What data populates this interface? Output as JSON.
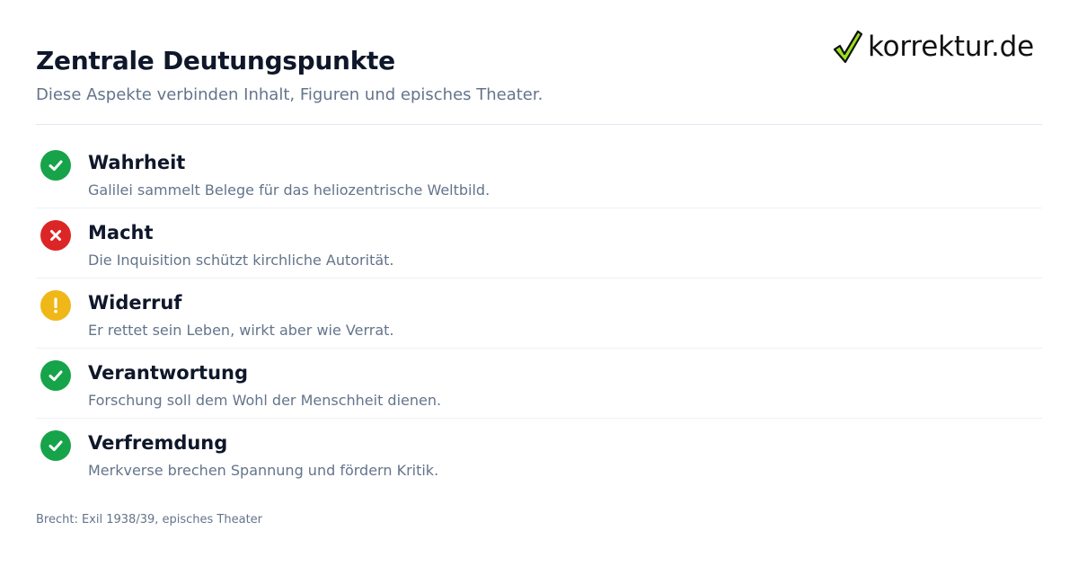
{
  "header": {
    "title": "Zentrale Deutungspunkte",
    "subtitle": "Diese Aspekte verbinden Inhalt, Figuren und episches Theater."
  },
  "logo": {
    "text": "korrektur.de",
    "icon": "checkmark-icon",
    "colors": {
      "check_fill": "#9be21f",
      "check_outline": "#111111"
    }
  },
  "colors": {
    "ok": "#16a34a",
    "error": "#dc2626",
    "warning": "#f0b719",
    "text_primary": "#0f172a",
    "text_secondary": "#64748b"
  },
  "items": [
    {
      "status": "ok",
      "icon": "check-circle-icon",
      "title": "Wahrheit",
      "description": "Galilei sammelt Belege für das heliozentrische Weltbild."
    },
    {
      "status": "error",
      "icon": "x-circle-icon",
      "title": "Macht",
      "description": "Die Inquisition schützt kirchliche Autorität."
    },
    {
      "status": "warning",
      "icon": "exclamation-circle-icon",
      "title": "Widerruf",
      "description": "Er rettet sein Leben, wirkt aber wie Verrat."
    },
    {
      "status": "ok",
      "icon": "check-circle-icon",
      "title": "Verantwortung",
      "description": "Forschung soll dem Wohl der Menschheit dienen."
    },
    {
      "status": "ok",
      "icon": "check-circle-icon",
      "title": "Verfremdung",
      "description": "Merkverse brechen Spannung und fördern Kritik."
    }
  ],
  "footer": {
    "text": "Brecht: Exil 1938/39, episches Theater"
  }
}
